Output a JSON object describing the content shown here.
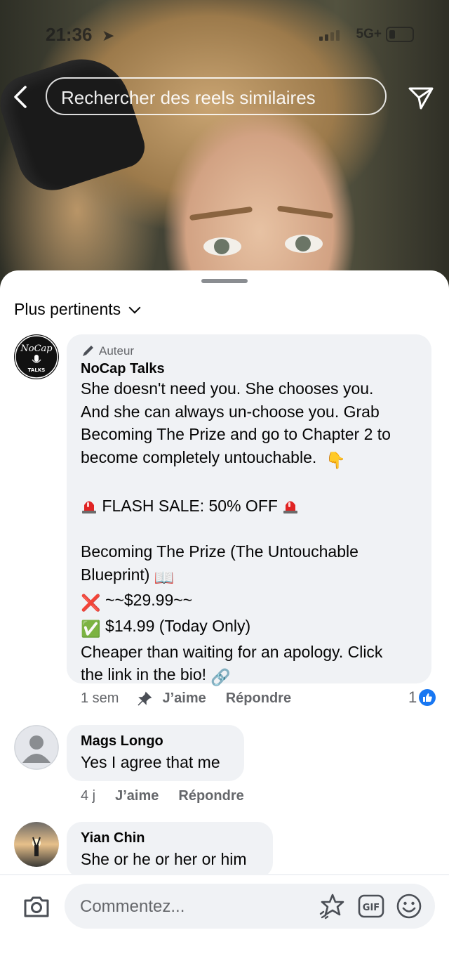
{
  "status_bar": {
    "time": "21:36",
    "network": "5G+"
  },
  "header": {
    "search_placeholder": "Rechercher des reels similaires"
  },
  "sheet": {
    "sort_label": "Plus pertinents"
  },
  "comments": [
    {
      "author_badge": "Auteur",
      "name": "NoCap Talks",
      "avatar_text_top": "NoCap",
      "avatar_text_bottom": "TALKS",
      "lines": [
        "She doesn't need you. She chooses you.",
        "And she can always un-choose you. Grab",
        "Becoming The Prize and go to Chapter 2 to",
        "become completely untouchable.",
        "FLASH SALE: 50% OFF",
        "Becoming The Prize (The Untouchable",
        "Blueprint)",
        "~~$29.99~~",
        "$14.99 (Today Only)",
        "Cheaper than waiting for an apology. Click",
        "the link in the bio!"
      ],
      "emojis": {
        "point_down": "👇",
        "book": "📖",
        "cross": "❌",
        "check": "✅",
        "link": "🔗"
      },
      "time": "1 sem",
      "like_label": "J’aime",
      "reply_label": "Répondre",
      "reaction_count": "1"
    },
    {
      "name": "Mags Longo",
      "text": "Yes I agree that me",
      "time": "4 j",
      "like_label": "J’aime",
      "reply_label": "Répondre"
    },
    {
      "name": "Yian Chin",
      "text": "She or he or her or him"
    }
  ],
  "composer": {
    "placeholder": "Commentez...",
    "gif_label": "GIF"
  },
  "colors": {
    "accent": "#1877f2",
    "bubble": "#f0f2f5",
    "secondary_text": "#65676b",
    "siren": "#e02424"
  }
}
